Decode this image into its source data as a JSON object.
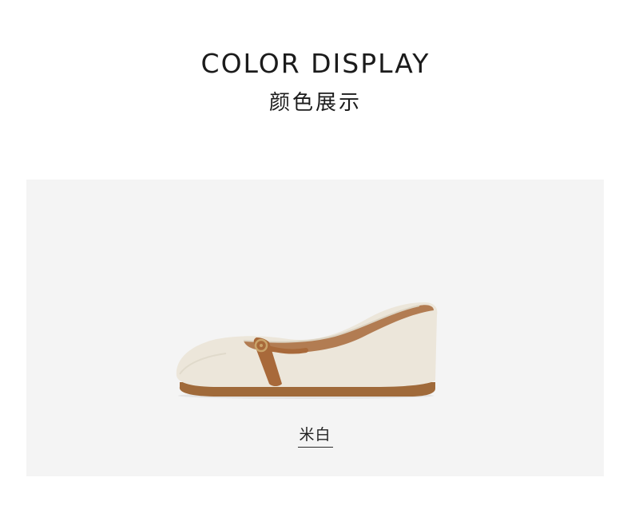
{
  "header": {
    "title_en": "COLOR DISPLAY",
    "title_cn": "颜色展示"
  },
  "product": {
    "color_name": "米白",
    "image": "beige-mary-jane-flat-shoe"
  },
  "colors": {
    "panel_bg": "#f4f4f4",
    "shoe_body": "#ece6da",
    "strap": "#a8693a",
    "sole": "#a06a3a"
  }
}
